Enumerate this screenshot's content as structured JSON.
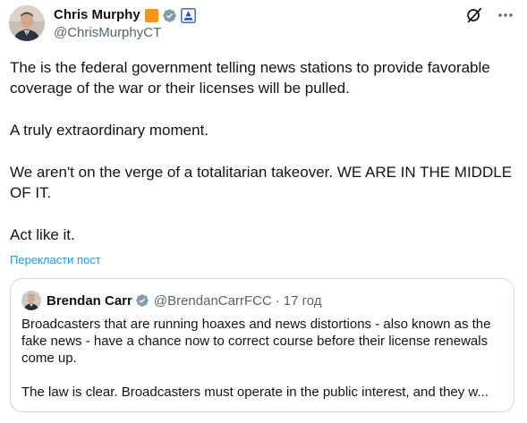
{
  "author": {
    "display_name": "Chris Murphy",
    "handle": "@ChrisMurphyCT"
  },
  "tweet": {
    "paragraphs": [
      "The is the federal government telling news stations to provide favorable coverage of the war or their licenses will be pulled.",
      "A truly extraordinary moment.",
      "We aren't on the verge of a totalitarian takeover. WE ARE IN THE MIDDLE OF IT.",
      "Act like it."
    ],
    "translate_label": "Перекласти пост"
  },
  "quoted": {
    "display_name": "Brendan Carr",
    "handle": "@BrendanCarrFCC",
    "separator": "·",
    "time": "17 год",
    "paragraphs": [
      "Broadcasters that are running hoaxes and news distortions - also known as the fake news - have a chance now to correct course before their license renewals come up.",
      "The law is clear.  Broadcasters must operate in the public interest, and they w..."
    ]
  },
  "colors": {
    "accent": "#1d9bf0",
    "badge_orange": "#f7931a",
    "verified_gray": "#829aab",
    "secondary_text": "#536471",
    "border": "#cfd9de"
  },
  "icons": [
    "orange-badge-icon",
    "verified-badge-icon",
    "government-affiliation-icon",
    "grok-icon",
    "more-options-icon"
  ]
}
